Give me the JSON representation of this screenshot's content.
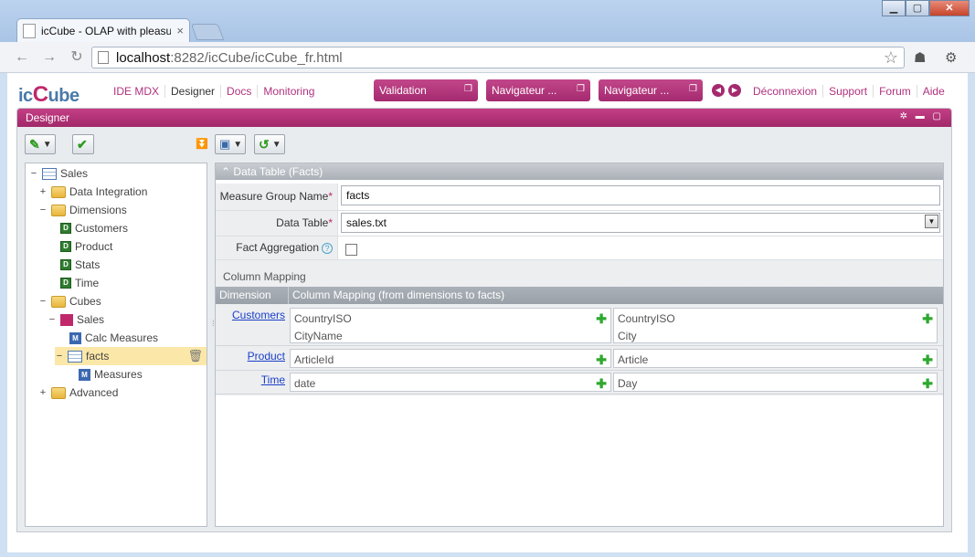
{
  "browser": {
    "tab_title": "icCube - OLAP with pleasu",
    "tab_close": "×",
    "url_host": "localhost",
    "url_rest": ":8282/icCube/icCube_fr.html",
    "back": "←",
    "forward": "→",
    "reload": "↻",
    "star": "☆",
    "minimize": "▁",
    "maximize": "▢",
    "close": "✕"
  },
  "app": {
    "logo_ic": "ic",
    "logo_c": "C",
    "logo_ube": "ube",
    "menu_left": [
      "IDE MDX",
      "Designer",
      "Docs",
      "Monitoring"
    ],
    "pills": [
      "Validation",
      "Navigateur ...",
      "Navigateur ..."
    ],
    "menu_right": [
      "Déconnexion",
      "Support",
      "Forum",
      "Aide"
    ]
  },
  "panel": {
    "title": "Designer",
    "controls": "✲ ▬ ▢"
  },
  "tree": {
    "items": [
      {
        "label": "Sales",
        "exp": "−"
      },
      {
        "label": "Data Integration",
        "exp": "+"
      },
      {
        "label": "Dimensions",
        "exp": "−"
      },
      {
        "label": "Customers",
        "exp": ""
      },
      {
        "label": "Product",
        "exp": ""
      },
      {
        "label": "Stats",
        "exp": ""
      },
      {
        "label": "Time",
        "exp": ""
      },
      {
        "label": "Cubes",
        "exp": "−"
      },
      {
        "label": "Sales",
        "exp": "−"
      },
      {
        "label": "Calc Measures",
        "exp": ""
      },
      {
        "label": "facts",
        "exp": "−"
      },
      {
        "label": "Measures",
        "exp": ""
      },
      {
        "label": "Advanced",
        "exp": "+"
      }
    ]
  },
  "form": {
    "section_title": "Data Table (Facts)",
    "measure_group_label": "Measure Group Name",
    "measure_group_value": "facts",
    "data_table_label": "Data Table",
    "data_table_value": "sales.txt",
    "fact_aggregation_label": "Fact Aggregation",
    "help": "?",
    "required_mark": "*",
    "column_mapping_label": "Column Mapping",
    "col_header_dimension": "Dimension",
    "col_header_mapping": "Column Mapping (from dimensions to facts)",
    "rows": [
      {
        "dimension": "Customers",
        "left": [
          "CountryISO",
          "CityName"
        ],
        "right": [
          "CountryISO",
          "City"
        ]
      },
      {
        "dimension": "Product",
        "left": [
          "ArticleId"
        ],
        "right": [
          "Article"
        ]
      },
      {
        "dimension": "Time",
        "left": [
          "date"
        ],
        "right": [
          "Day"
        ]
      }
    ]
  },
  "colors": {
    "brand": "#b0327f",
    "panel_title": "#a12869",
    "link": "#1a3ec8",
    "add": "#2ea82e"
  },
  "icons": [
    "page-icon",
    "back-icon",
    "forward-icon",
    "reload-icon",
    "star-icon",
    "wrench-icon",
    "folder-icon",
    "dimension-icon",
    "cube-icon",
    "measure-icon",
    "table-icon",
    "trash-icon",
    "plus-icon",
    "help-icon",
    "save-icon",
    "undo-icon",
    "check-icon"
  ]
}
